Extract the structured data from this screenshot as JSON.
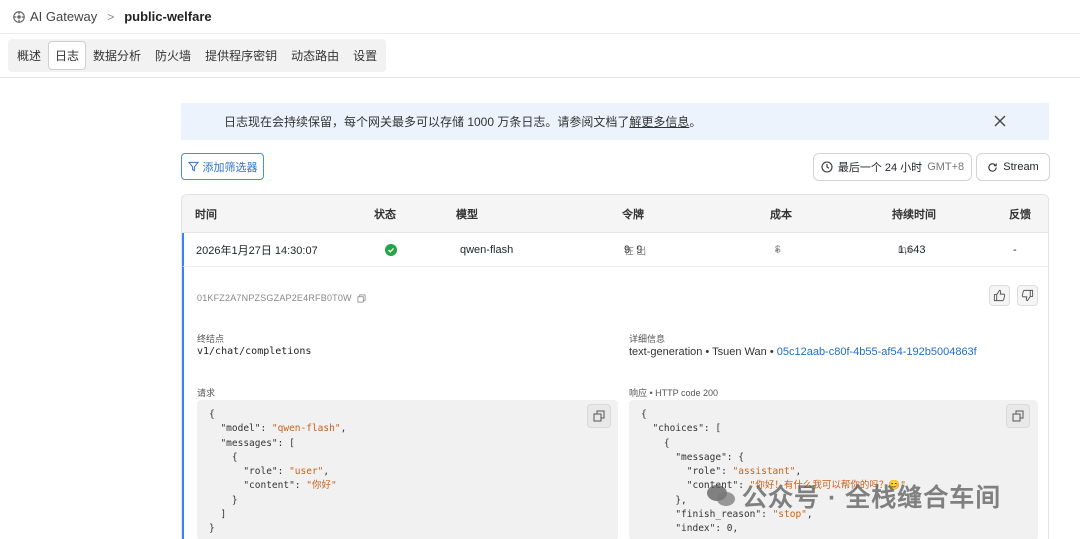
{
  "breadcrumb": {
    "app": "AI Gateway",
    "separator": ">",
    "gateway": "public-welfare"
  },
  "tabs": [
    "概述",
    "日志",
    "数据分析",
    "防火墙",
    "提供程序密钥",
    "动态路由",
    "设置"
  ],
  "active_tab": "日志",
  "banner": {
    "text_before": "日志现在会持续保留，每个网关最多可以存储 1000 万条日志。请参阅文档了",
    "link": "解更多信息",
    "text_after": "。"
  },
  "toolbar": {
    "filter_label": "添加筛选器",
    "time_label": "最后一个 24 小时",
    "timezone": "GMT+8",
    "stream_label": "Stream"
  },
  "table": {
    "headers": {
      "time": "时间",
      "status": "状态",
      "model": "模型",
      "tokens": "令牌",
      "cost": "成本",
      "duration": "持续时间",
      "feedback": "反馈"
    },
    "row": {
      "time": "2026年1月27日 14:30:07",
      "model": "qwen-flash",
      "tokens_in": "9",
      "in_unit": "在",
      "tokens_out": "9",
      "out_unit": "出",
      "cost_symbol": "$",
      "cost": "-",
      "duration": "1,643",
      "duration_unit": "ms",
      "feedback": "-"
    }
  },
  "detail": {
    "request_id": "01KFZ2A7NPZSGZAP2E4RFB0T0W",
    "endpoint_label": "终结点",
    "endpoint_value": "v1/chat/completions",
    "info_label": "详细信息",
    "info_value": "text-generation • Tsuen Wan • ",
    "info_link": "05c12aab-c80f-4b55-af54-192b5004863f",
    "request_label": "请求",
    "response_label": "响应 • HTTP code 200",
    "request_lines": [
      "{",
      "  \"model\": \"qwen-flash\",",
      "  \"messages\": [",
      "    {",
      "      \"role\": \"user\",",
      "      \"content\": \"你好\"",
      "    }",
      "  ]",
      "}"
    ],
    "response_lines": [
      "{",
      "  \"choices\": [",
      "    {",
      "      \"message\": {",
      "        \"role\": \"assistant\",",
      "        \"content\": \"你好！有什么我可以帮你的吗？😊\"",
      "      },",
      "      \"finish_reason\": \"stop\",",
      "      \"index\": 0,"
    ]
  },
  "watermark": "公众号 · 全栈缝合车间"
}
